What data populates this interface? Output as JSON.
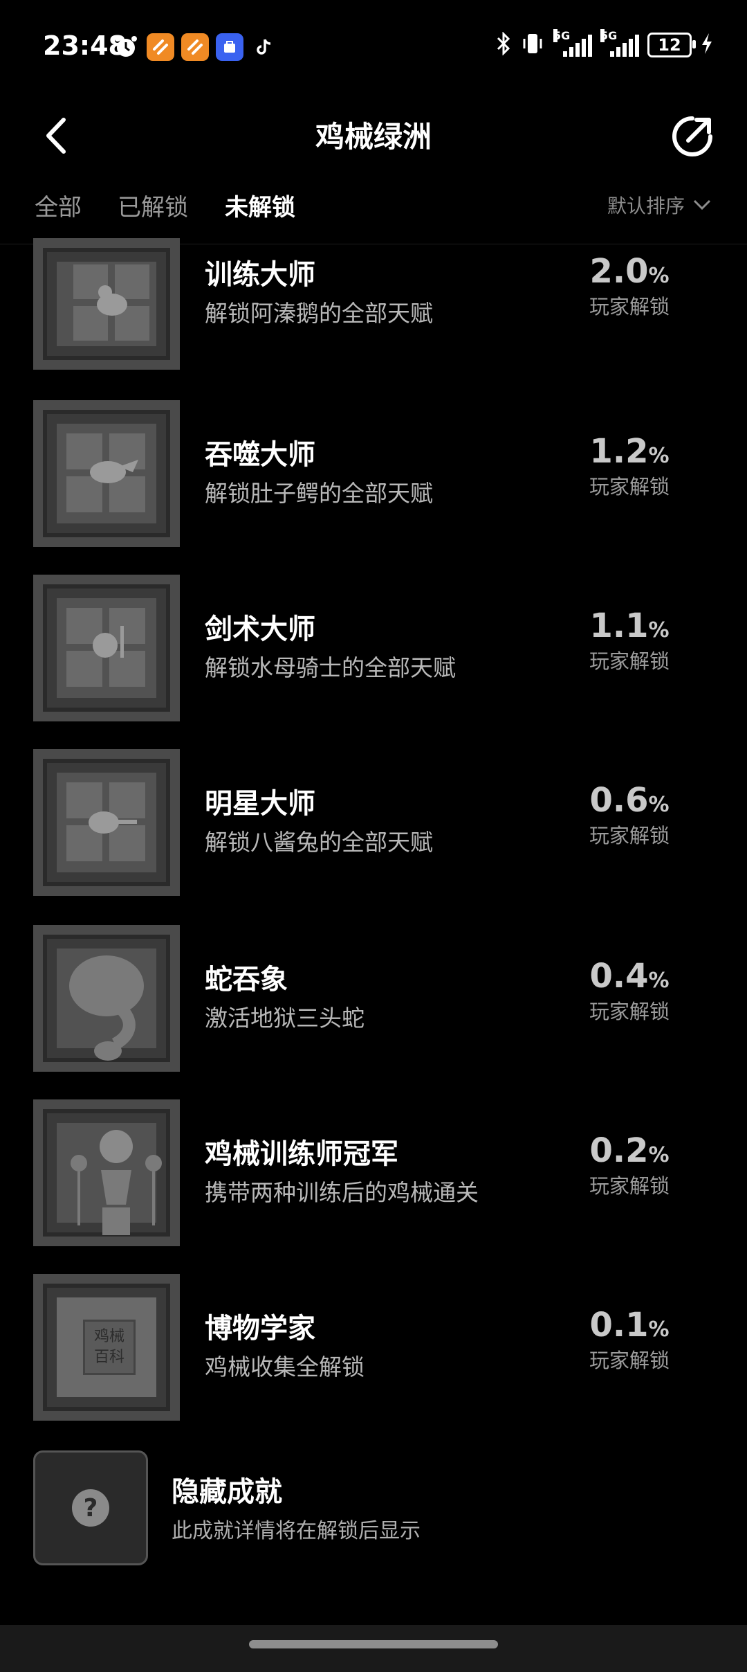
{
  "status_bar": {
    "time": "23:48",
    "signal1_label": "5G",
    "signal2_label": "5G",
    "battery": "12",
    "icons": [
      "alarm-icon",
      "taobao-app-icon",
      "taobao-app-icon-2",
      "app-manager-icon",
      "tiktok-icon",
      "bluetooth-icon",
      "vibrate-icon",
      "charging-icon"
    ]
  },
  "header": {
    "title": "鸡械绿洲",
    "back_icon": "chevron-left-icon",
    "share_icon": "share-icon"
  },
  "tabs": {
    "items": [
      {
        "label": "全部"
      },
      {
        "label": "已解锁"
      },
      {
        "label": "未解锁",
        "active": true
      }
    ],
    "sort_label": "默认排序"
  },
  "achievements": [
    {
      "title": "训练大师",
      "desc": "解锁阿溱鹅的全部天赋",
      "percent": "2.0",
      "unit": "%",
      "stat_label": "玩家解锁"
    },
    {
      "title": "吞噬大师",
      "desc": "解锁肚子鳄的全部天赋",
      "percent": "1.2",
      "unit": "%",
      "stat_label": "玩家解锁"
    },
    {
      "title": "剑术大师",
      "desc": "解锁水母骑士的全部天赋",
      "percent": "1.1",
      "unit": "%",
      "stat_label": "玩家解锁"
    },
    {
      "title": "明星大师",
      "desc": "解锁八酱兔的全部天赋",
      "percent": "0.6",
      "unit": "%",
      "stat_label": "玩家解锁"
    },
    {
      "title": "蛇吞象",
      "desc": "激活地狱三头蛇",
      "percent": "0.4",
      "unit": "%",
      "stat_label": "玩家解锁"
    },
    {
      "title": "鸡械训练师冠军",
      "desc": "携带两种训练后的鸡械通关",
      "percent": "0.2",
      "unit": "%",
      "stat_label": "玩家解锁"
    },
    {
      "title": "博物学家",
      "desc": "鸡械收集全解锁",
      "percent": "0.1",
      "unit": "%",
      "stat_label": "玩家解锁",
      "badge_text_1": "鸡械",
      "badge_text_2": "百科"
    }
  ],
  "hidden": {
    "title": "隐藏成就",
    "desc": "此成就详情将在解锁后显示",
    "icon_glyph": "?"
  }
}
